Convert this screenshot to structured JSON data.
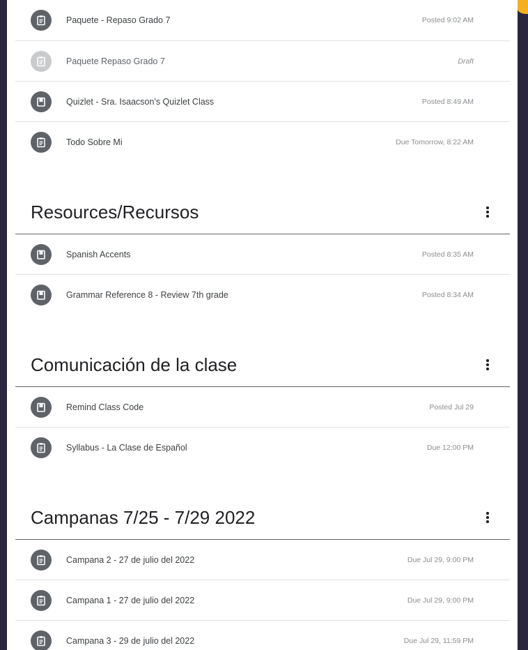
{
  "colors": {
    "accent": "#f5b021",
    "icon_bg": "#5f6368",
    "draft_icon_bg": "#c9cacc"
  },
  "top_items": [
    {
      "title": "Paquete - Repaso Grado 7",
      "meta": "Posted 9:02 AM",
      "icon": "assignment-icon"
    },
    {
      "title": "Paquete Repaso Grado 7",
      "meta": "Draft",
      "icon": "assignment-icon"
    },
    {
      "title": "Quizlet - Sra. Isaacson's Quizlet Class",
      "meta": "Posted 8:49 AM",
      "icon": "material-icon"
    },
    {
      "title": "Todo Sobre Mi",
      "meta": "Due Tomorrow, 8:22 AM",
      "icon": "assignment-icon"
    }
  ],
  "sections": [
    {
      "title": "Resources/Recursos",
      "items": [
        {
          "title": "Spanish Accents",
          "meta": "Posted 8:35 AM",
          "icon": "material-icon"
        },
        {
          "title": "Grammar Reference 8 - Review 7th grade",
          "meta": "Posted 8:34 AM",
          "icon": "material-icon"
        }
      ]
    },
    {
      "title": "Comunicación de la clase",
      "items": [
        {
          "title": "Remind Class Code",
          "meta": "Posted Jul 29",
          "icon": "material-icon"
        },
        {
          "title": "Syllabus - La Clase de Español",
          "meta": "Due 12:00 PM",
          "icon": "assignment-icon"
        }
      ]
    },
    {
      "title": "Campanas 7/25 - 7/29 2022",
      "items": [
        {
          "title": "Campana 2 - 27 de julio del 2022",
          "meta": "Due Jul 29, 9:00 PM",
          "icon": "assignment-icon"
        },
        {
          "title": "Campana 1 - 27 de julio del 2022",
          "meta": "Due Jul 29, 9:00 PM",
          "icon": "assignment-icon"
        },
        {
          "title": "Campana 3 - 29 de julio del 2022",
          "meta": "Due Jul 29, 11:59 PM",
          "icon": "assignment-icon"
        }
      ]
    }
  ]
}
